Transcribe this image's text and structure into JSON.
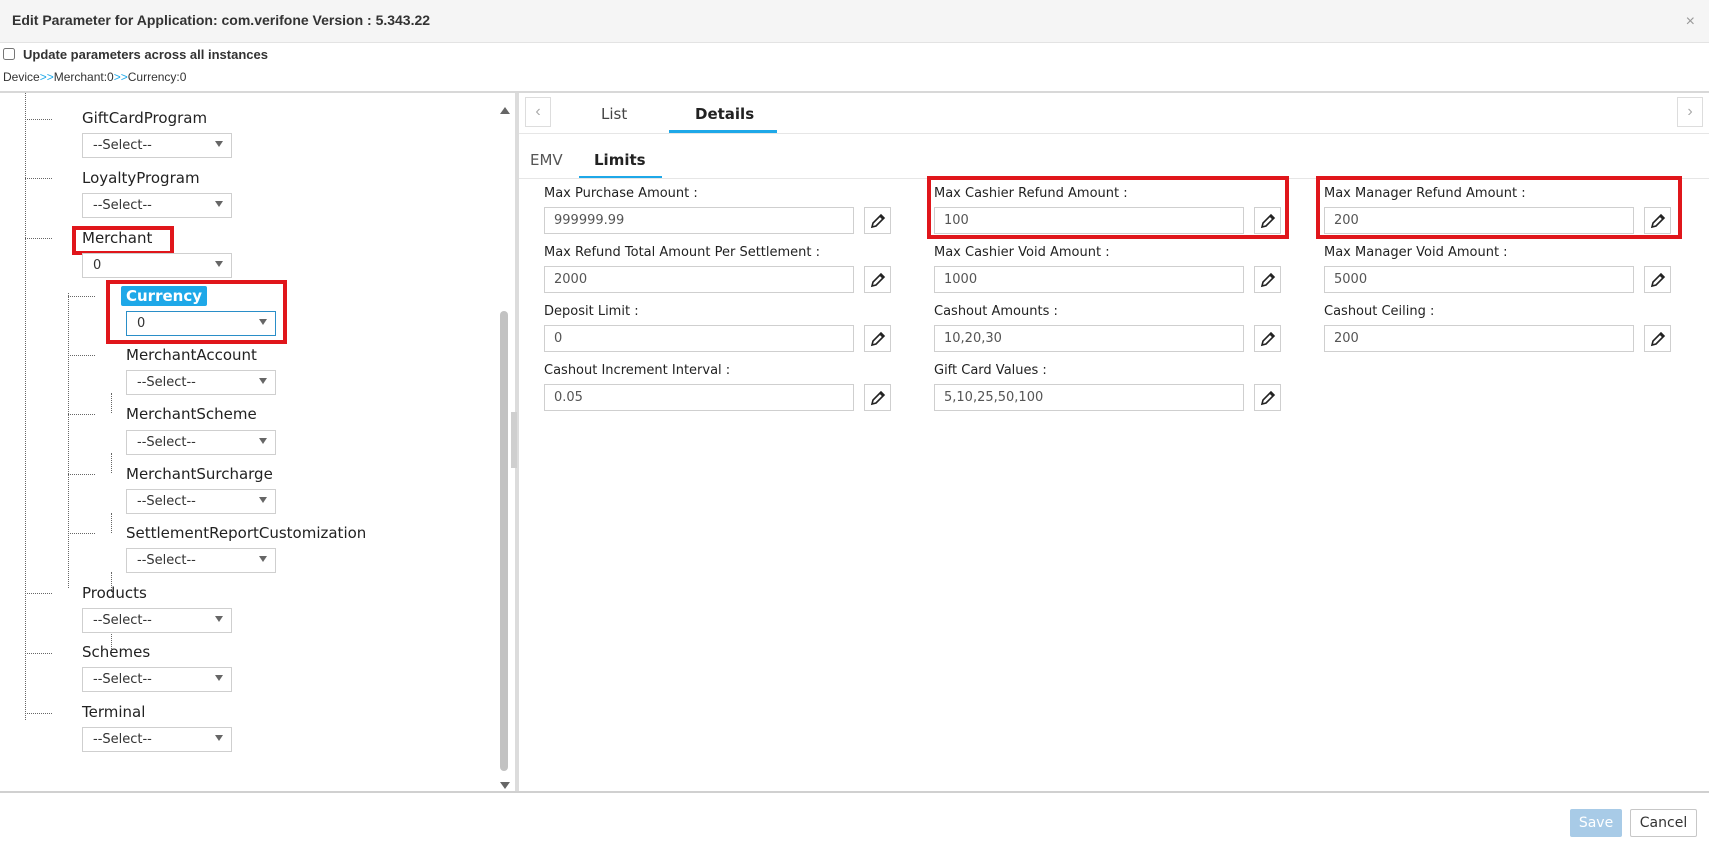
{
  "dialog": {
    "title": "Edit Parameter for Application: com.verifone Version : 5.343.22",
    "close_icon": "×",
    "update_label": "Update parameters across all instances"
  },
  "breadcrumb": {
    "parts": [
      "Device",
      ">>",
      "Merchant:0",
      ">>",
      "Currency:0"
    ]
  },
  "tree": {
    "nodes": [
      {
        "label": "GiftCardProgram",
        "value": "--Select--"
      },
      {
        "label": "LoyaltyProgram",
        "value": "--Select--"
      },
      {
        "label": "Merchant",
        "value": "0"
      },
      {
        "label": "Currency",
        "value": "0"
      },
      {
        "label": "MerchantAccount",
        "value": "--Select--"
      },
      {
        "label": "MerchantScheme",
        "value": "--Select--"
      },
      {
        "label": "MerchantSurcharge",
        "value": "--Select--"
      },
      {
        "label": "SettlementReportCustomization",
        "value": "--Select--"
      },
      {
        "label": "Products",
        "value": "--Select--"
      },
      {
        "label": "Schemes",
        "value": "--Select--"
      },
      {
        "label": "Terminal",
        "value": "--Select--"
      }
    ]
  },
  "tabs": {
    "prev_icon": "‹",
    "next_icon": "›",
    "list": "List",
    "details": "Details"
  },
  "subtabs": {
    "emv": "EMV",
    "limits": "Limits"
  },
  "fields": [
    {
      "label": "Max Purchase Amount :",
      "value": "999999.99"
    },
    {
      "label": "Max Cashier Refund Amount :",
      "value": "100"
    },
    {
      "label": "Max Manager Refund Amount :",
      "value": "200"
    },
    {
      "label": "Max Refund Total Amount Per Settlement :",
      "value": "2000"
    },
    {
      "label": "Max Cashier Void Amount :",
      "value": "1000"
    },
    {
      "label": "Max Manager Void Amount :",
      "value": "5000"
    },
    {
      "label": "Deposit Limit :",
      "value": "0"
    },
    {
      "label": "Cashout Amounts :",
      "value": "10,20,30"
    },
    {
      "label": "Cashout Ceiling :",
      "value": "200"
    },
    {
      "label": "Cashout Increment Interval :",
      "value": "0.05"
    },
    {
      "label": "Gift Card Values :",
      "value": "5,10,25,50,100"
    }
  ],
  "footer": {
    "save": "Save",
    "cancel": "Cancel"
  },
  "colors": {
    "accent": "#1ea8e8",
    "highlight": "#e0161b",
    "save_disabled": "#a8cbe7"
  }
}
